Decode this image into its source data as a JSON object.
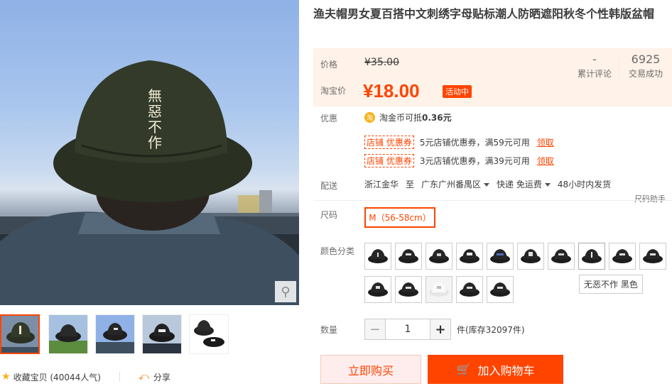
{
  "product": {
    "title": "渔夫帽男女夏百搭中文刺绣字母贴标潮人防晒遮阳秋冬个性韩版盆帽",
    "hat_embroidery": [
      "無",
      "惡",
      "不",
      "作"
    ]
  },
  "price": {
    "label": "价格",
    "original": "¥35.00",
    "promo_label": "淘宝价",
    "promo": "¥18.00",
    "promo_badge": "活动中"
  },
  "stats": {
    "reviews_value": "-",
    "reviews_label": "累计评论",
    "sales_value": "6925",
    "sales_label": "交易成功"
  },
  "benefits": {
    "label": "优惠",
    "coin_icon": "淘",
    "coin_text": "淘金币可抵",
    "coin_amount": "0.36元",
    "coupons": [
      {
        "tag": "店铺 优惠券",
        "text": "5元店铺优惠券，满59元可用",
        "link": "领取"
      },
      {
        "tag": "店铺 优惠券",
        "text": "3元店铺优惠券，满39元可用",
        "link": "领取"
      }
    ]
  },
  "delivery": {
    "label": "配送",
    "from": "浙江金华",
    "to_word": "至",
    "to": "广东广州番禺区",
    "method": "快递 免运费",
    "ship_time": "48小时内发货"
  },
  "size": {
    "label": "尺码",
    "help": "尺码助手",
    "selected": "M（56-58cm）"
  },
  "colors": {
    "label": "颜色分类",
    "tooltip": "无恶不作 黑色"
  },
  "quantity": {
    "label": "数量",
    "value": "1",
    "minus": "−",
    "plus": "+",
    "stock": "件(库存32097件)"
  },
  "buttons": {
    "buy_now": "立即购买",
    "add_cart": "加入购物车"
  },
  "actions": {
    "favorite": "收藏宝贝 (40044人气)",
    "share": "分享"
  },
  "colors_theme": {
    "accent": "#ff4400",
    "price_bg": "#fff2e8"
  }
}
